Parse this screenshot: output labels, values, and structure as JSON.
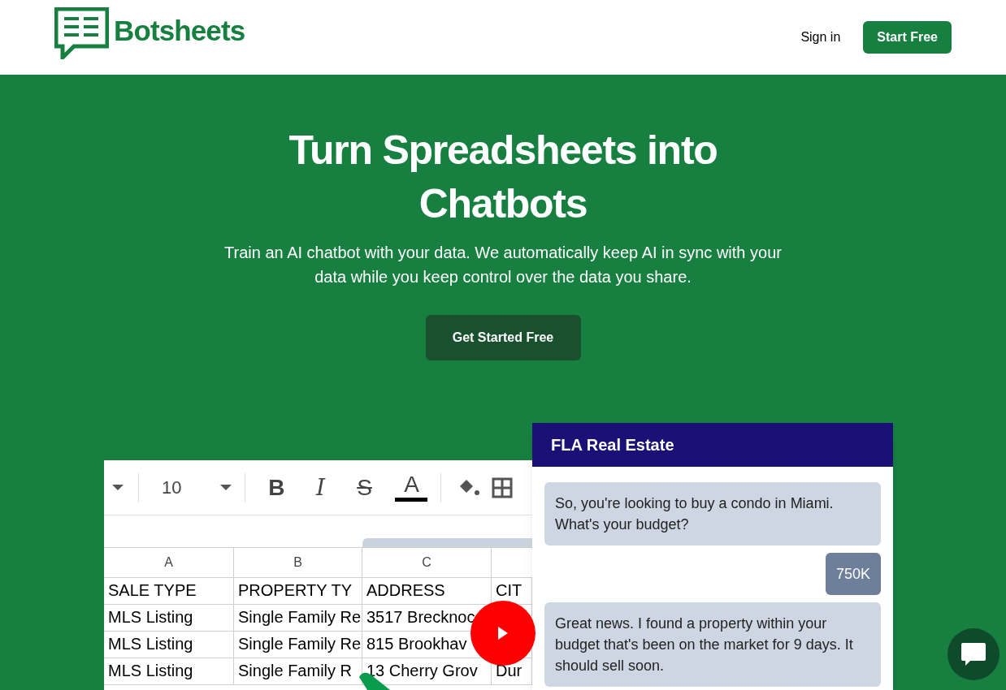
{
  "header": {
    "brand": "Botsheets",
    "nav": [
      {
        "label": "Sign in",
        "kind": "link"
      },
      {
        "label": "Start Free",
        "kind": "button"
      }
    ]
  },
  "hero": {
    "title_lines": [
      "Turn Spreadsheets into",
      "Chatbots"
    ],
    "subtitle_lines": [
      "Train an AI chatbot with your data. We automatically keep AI in sync with your",
      "data while you keep control over the data you share."
    ],
    "cta": "Get Started Free"
  },
  "spreadsheet": {
    "font_size": "10",
    "format_buttons": [
      {
        "label": "B",
        "kind": "bold"
      },
      {
        "label": "I",
        "kind": "italic"
      },
      {
        "label": "S",
        "kind": "strike"
      },
      {
        "label": "A",
        "kind": "color"
      }
    ],
    "columns": [
      "A",
      "B",
      "C"
    ],
    "rows": [
      [
        "SALE TYPE",
        "PROPERTY TY",
        "ADDRESS",
        "CIT"
      ],
      [
        "MLS Listing",
        "Single Family Re",
        "3517 Brecknoc",
        ""
      ],
      [
        "MLS Listing",
        "Single Family Re",
        "815 Brookhav",
        ""
      ],
      [
        "MLS Listing",
        "Single Family R",
        "13 Cherry Grov",
        "Dur"
      ]
    ]
  },
  "chat": {
    "title": "FLA Real Estate",
    "messages": [
      {
        "kind": "bot",
        "text": "So, you're looking to buy a condo in Miami. What's your budget?"
      },
      {
        "kind": "user",
        "text": "750K"
      },
      {
        "kind": "bot",
        "text": "Great news. I found a property within your budget that's been on the market for 9 days. It should sell soon."
      }
    ]
  }
}
